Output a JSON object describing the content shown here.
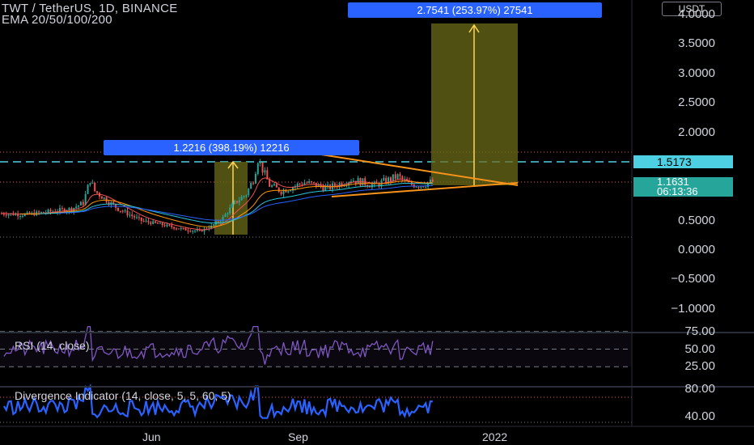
{
  "header": {
    "symbol_line": "TWT / TetherUS, 1D, BINANCE",
    "ema_line": "EMA 20/50/100/200"
  },
  "currency_badge": "USDT",
  "measure_tips": {
    "left": "1.2216 (398.19%) 12216",
    "right": "2.7541 (253.97%) 27541"
  },
  "price_axis": {
    "ticks": [
      {
        "label": "4.0000",
        "value": 4.0
      },
      {
        "label": "3.5000",
        "value": 3.5
      },
      {
        "label": "3.0000",
        "value": 3.0
      },
      {
        "label": "2.5000",
        "value": 2.5
      },
      {
        "label": "2.0000",
        "value": 2.0
      },
      {
        "label": "0.5000",
        "value": 0.5
      },
      {
        "label": "0.0000",
        "value": 0.0
      },
      {
        "label": "−0.5000",
        "value": -0.5
      },
      {
        "label": "−1.0000",
        "value": -1.0
      }
    ],
    "horizontal_line_label": "1.5173",
    "last_price_label": "1.1631",
    "countdown_label": "06:13:36"
  },
  "rsi_panel": {
    "title": "RSI (14, close)",
    "ticks": [
      {
        "label": "75.00",
        "value": 75
      },
      {
        "label": "50.00",
        "value": 50
      },
      {
        "label": "25.00",
        "value": 25
      }
    ]
  },
  "divergence_panel": {
    "title": "Divergence Indicator (14, close, 5, 5, 60, 5)",
    "ticks": [
      {
        "label": "80.00",
        "value": 80
      },
      {
        "label": "40.00",
        "value": 40
      }
    ]
  },
  "time_axis": {
    "labels": [
      "Jun",
      "Sep",
      "2022"
    ]
  },
  "colors": {
    "background": "#000000",
    "up": "#26a69a",
    "down": "#ef5350",
    "triangle": "#f7931a",
    "measure_box": "#6b6b1a",
    "measure_arrow": "#ffd54f",
    "horizontal_line": "#4dd0e1",
    "rsi_line": "#7e57c2",
    "divergence_line": "#2962ff",
    "tip_bg": "#2962ff"
  },
  "chart_data": {
    "type": "candlestick",
    "series": [
      {
        "name": "TWT / TetherUS",
        "x_range_days": [
          0,
          185
        ],
        "approx_path": [
          [
            0,
            0.62
          ],
          [
            10,
            0.6
          ],
          [
            20,
            0.65
          ],
          [
            30,
            0.7
          ],
          [
            35,
            0.8
          ],
          [
            38,
            1.2
          ],
          [
            40,
            1.0
          ],
          [
            45,
            0.85
          ],
          [
            50,
            0.7
          ],
          [
            55,
            0.6
          ],
          [
            60,
            0.5
          ],
          [
            70,
            0.42
          ],
          [
            78,
            0.35
          ],
          [
            85,
            0.32
          ],
          [
            90,
            0.4
          ],
          [
            95,
            0.55
          ],
          [
            100,
            0.8
          ],
          [
            105,
            0.95
          ],
          [
            108,
            1.2
          ],
          [
            110,
            1.55
          ],
          [
            115,
            1.1
          ],
          [
            120,
            1.0
          ],
          [
            130,
            1.15
          ],
          [
            140,
            1.05
          ],
          [
            150,
            1.2
          ],
          [
            160,
            1.1
          ],
          [
            170,
            1.25
          ],
          [
            175,
            1.12
          ],
          [
            180,
            1.1
          ],
          [
            185,
            1.1631
          ]
        ]
      }
    ],
    "horizontal_line": 1.5173,
    "last_price": 1.1631,
    "ylim": [
      -1.2,
      4.1
    ]
  }
}
